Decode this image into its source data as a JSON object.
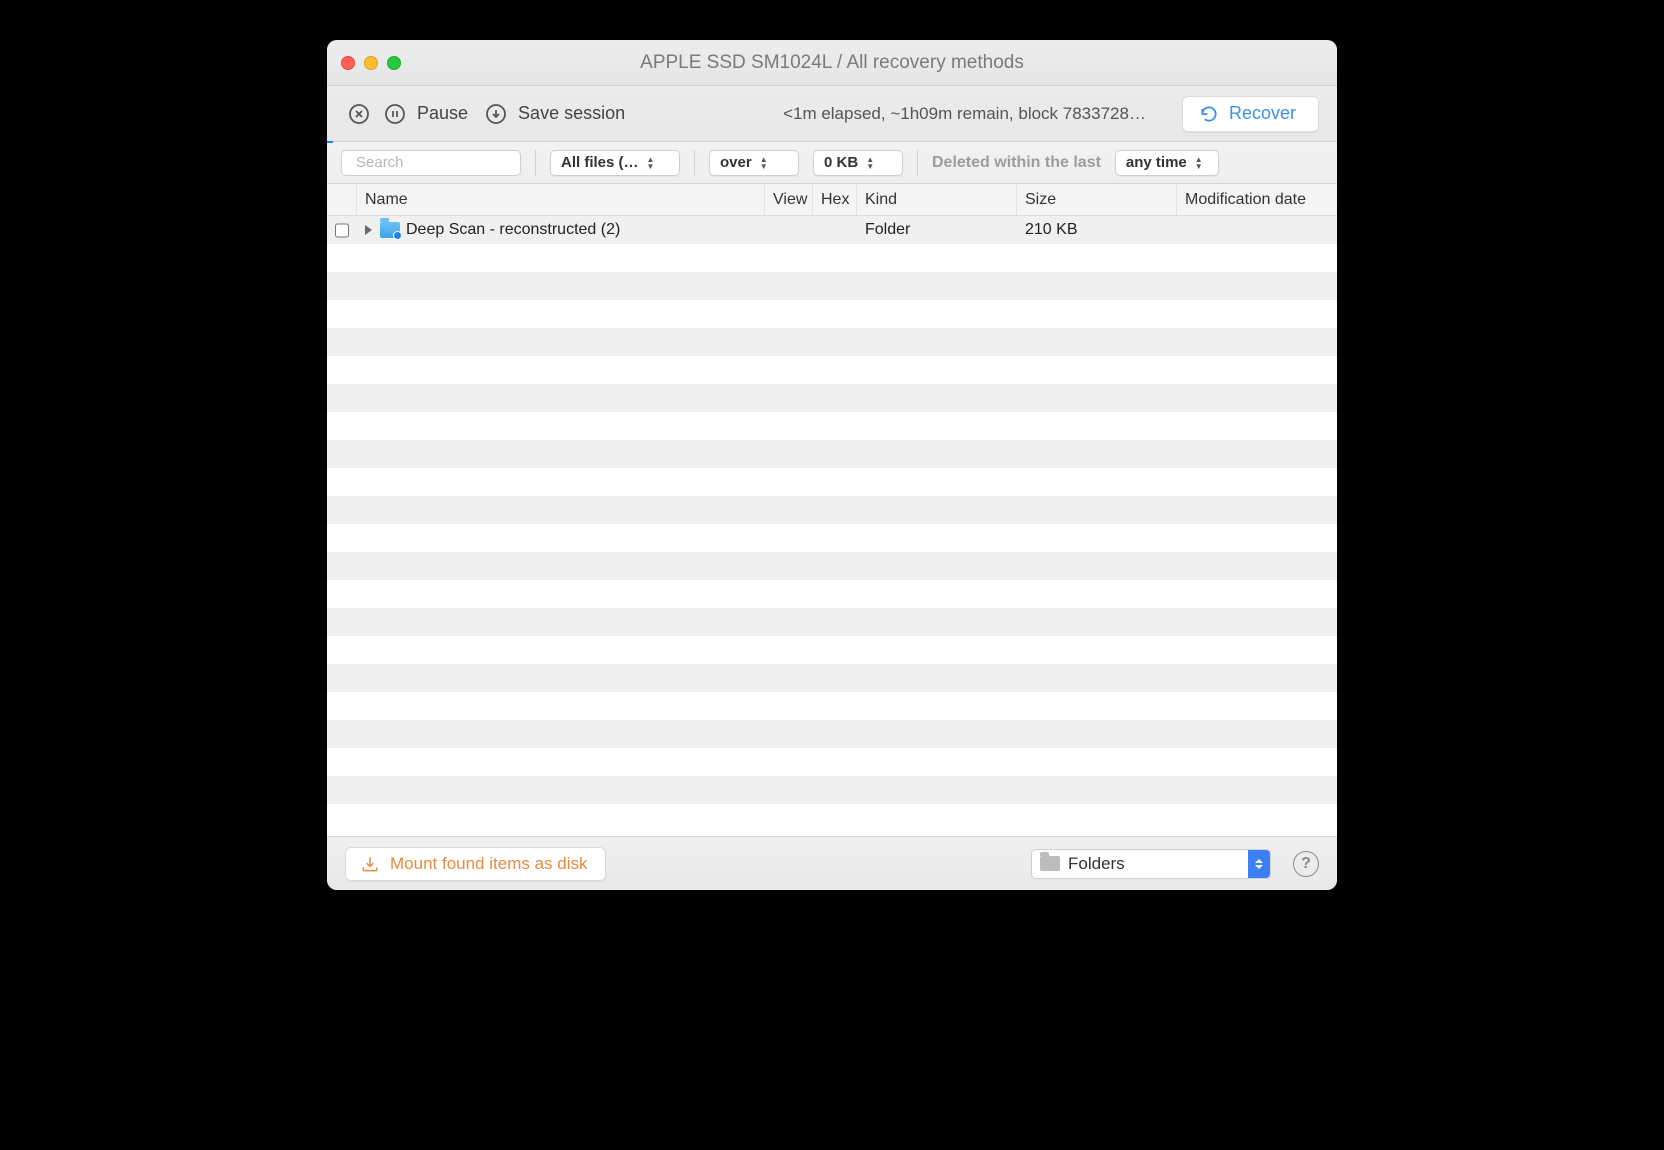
{
  "window": {
    "title": "APPLE SSD SM1024L / All recovery methods"
  },
  "toolbar": {
    "pause_label": "Pause",
    "save_session_label": "Save session",
    "status": "<1m elapsed, ~1h09m remain, block 7833728…",
    "recover_label": "Recover"
  },
  "filters": {
    "search_placeholder": "Search",
    "file_filter": "All files (…",
    "size_op": "over",
    "size_value": "0 KB",
    "deleted_label": "Deleted within the last",
    "deleted_value": "any time"
  },
  "columns": {
    "name": "Name",
    "view": "View",
    "hex": "Hex",
    "kind": "Kind",
    "size": "Size",
    "modification": "Modification date"
  },
  "rows": [
    {
      "name": "Deep Scan - reconstructed (2)",
      "kind": "Folder",
      "size": "210 KB",
      "modification": ""
    }
  ],
  "footer": {
    "mount_label": "Mount found items as disk",
    "view_select": "Folders"
  }
}
